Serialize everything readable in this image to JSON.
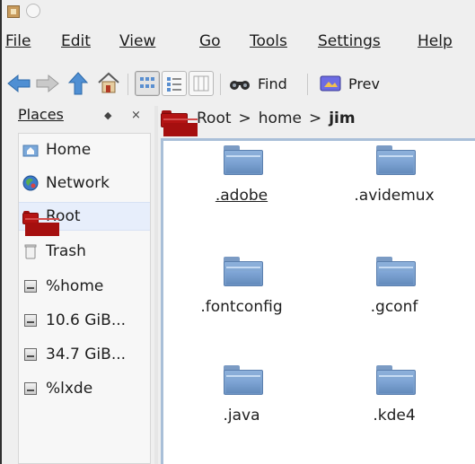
{
  "menu": {
    "items": [
      {
        "label": "File"
      },
      {
        "label": "Edit"
      },
      {
        "label": "View"
      },
      {
        "label": "Go"
      },
      {
        "label": "Tools"
      },
      {
        "label": "Settings"
      },
      {
        "label": "Help"
      }
    ]
  },
  "toolbar": {
    "find_label": "Find",
    "preview_label": "Prev"
  },
  "places": {
    "title": "Places",
    "items": [
      {
        "label": "Home",
        "icon": "home-folder-icon"
      },
      {
        "label": "Network",
        "icon": "network-globe-icon"
      },
      {
        "label": "Root",
        "icon": "red-folder-icon",
        "selected": true
      },
      {
        "label": "Trash",
        "icon": "trash-icon"
      },
      {
        "label": "%home",
        "icon": "drive-icon"
      },
      {
        "label": "10.6 GiB...",
        "icon": "drive-icon"
      },
      {
        "label": "34.7 GiB...",
        "icon": "drive-icon"
      },
      {
        "label": "%lxde",
        "icon": "drive-icon"
      }
    ]
  },
  "breadcrumb": {
    "parts": [
      "Root",
      "home",
      "jim"
    ]
  },
  "files": [
    {
      "label": ".adobe",
      "focused": true
    },
    {
      "label": ".avidemux"
    },
    {
      "label": ".fontconfig"
    },
    {
      "label": ".gconf"
    },
    {
      "label": ".java"
    },
    {
      "label": ".kde4"
    }
  ],
  "colors": {
    "selection": "#e7eefb",
    "content_border": "#a9bfd8",
    "folder_blue": "#7b9bc4",
    "root_red": "#b41313"
  }
}
